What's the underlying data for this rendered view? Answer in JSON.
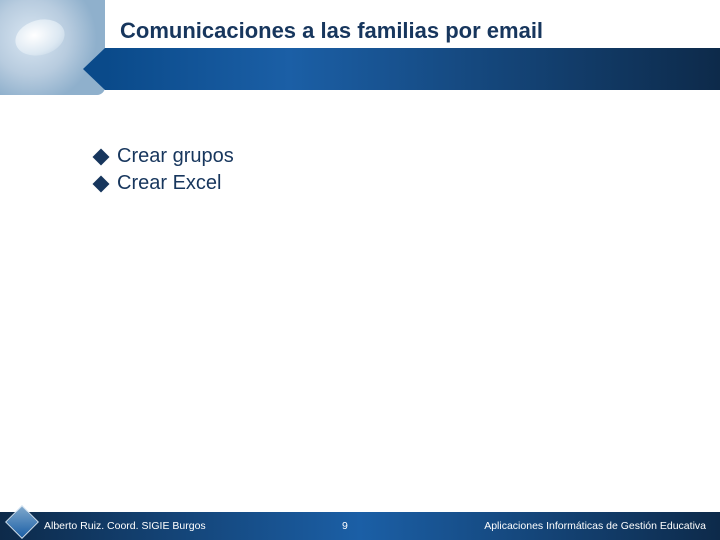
{
  "title": "Comunicaciones a las familias por email",
  "bullets": [
    "Crear grupos",
    "Crear Excel"
  ],
  "footer": {
    "author": "Alberto Ruiz. Coord. SIGIE Burgos",
    "page": "9",
    "course": "Aplicaciones Informáticas de Gestión Educativa"
  }
}
